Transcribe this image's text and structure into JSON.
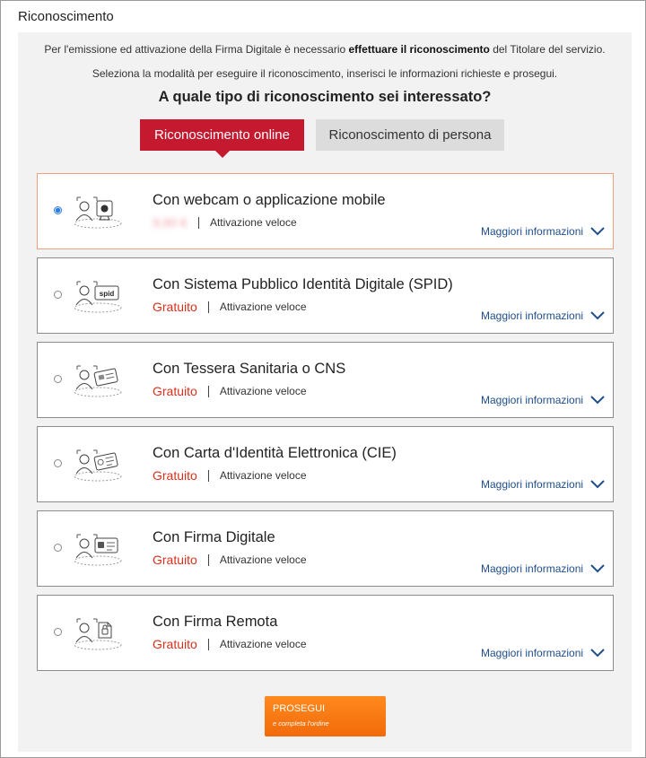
{
  "page": {
    "title": "Riconoscimento"
  },
  "intro": {
    "line1_before": "Per l'emissione ed attivazione della Firma Digitale è necessario ",
    "line1_bold": "effettuare il riconoscimento",
    "line1_after": " del Titolare del servizio.",
    "line2": "Seleziona la modalità per eseguire il riconoscimento, inserisci le informazioni richieste e prosegui.",
    "question": "A quale tipo di riconoscimento sei interessato?"
  },
  "tabs": [
    {
      "label": "Riconoscimento online",
      "active": true
    },
    {
      "label": "Riconoscimento di persona",
      "active": false
    }
  ],
  "options": [
    {
      "title": "Con webcam o applicazione mobile",
      "price": "9,90 €",
      "price_obscured": true,
      "note": "Attivazione veloce",
      "more": "Maggiori informazioni",
      "selected": true,
      "icon": "webcam-icon"
    },
    {
      "title": "Con Sistema Pubblico Identità Digitale (SPID)",
      "price": "Gratuito",
      "note": "Attivazione veloce",
      "more": "Maggiori informazioni",
      "selected": false,
      "icon": "spid-icon",
      "icon_text": "spid"
    },
    {
      "title": "Con Tessera Sanitaria o CNS",
      "price": "Gratuito",
      "note": "Attivazione veloce",
      "more": "Maggiori informazioni",
      "selected": false,
      "icon": "health-card-icon"
    },
    {
      "title": "Con Carta d'Identità Elettronica (CIE)",
      "price": "Gratuito",
      "note": "Attivazione veloce",
      "more": "Maggiori informazioni",
      "selected": false,
      "icon": "id-card-icon"
    },
    {
      "title": "Con Firma Digitale",
      "price": "Gratuito",
      "note": "Attivazione veloce",
      "more": "Maggiori informazioni",
      "selected": false,
      "icon": "digital-signature-card-icon"
    },
    {
      "title": "Con Firma Remota",
      "price": "Gratuito",
      "note": "Attivazione veloce",
      "more": "Maggiori informazioni",
      "selected": false,
      "icon": "remote-signature-icon"
    }
  ],
  "proceed": {
    "label": "PROSEGUI",
    "sublabel": "e completa l'ordine"
  },
  "colors": {
    "accent_red": "#c4192e",
    "price_red": "#d9301c",
    "link_blue": "#1f4e8a",
    "button_orange": "#f26a0a",
    "radio_blue": "#2b7de9"
  }
}
